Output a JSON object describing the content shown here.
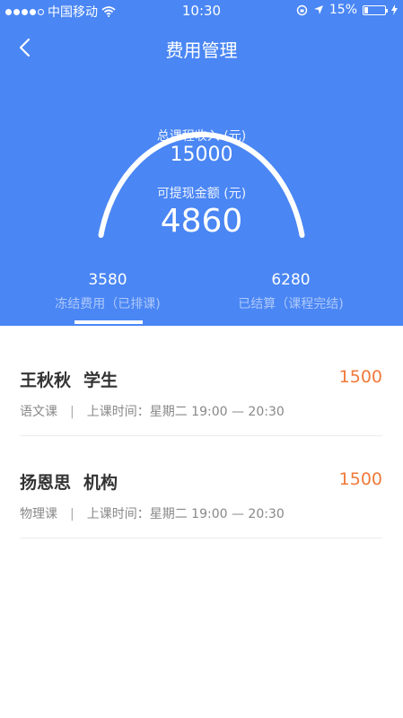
{
  "status_bar": {
    "carrier": "中国移动",
    "time": "10:30",
    "battery": "15%"
  },
  "nav": {
    "title": "费用管理",
    "back_icon": "chevron-left-icon"
  },
  "summary": {
    "income_label": "总课程收入 (元)",
    "income_value": "15000",
    "withdraw_label": "可提现金额 (元)",
    "withdraw_value": "4860"
  },
  "tabs": [
    {
      "value": "3580",
      "label": "冻结费用（已排课)"
    },
    {
      "value": "6280",
      "label": "已结算（课程完结)"
    }
  ],
  "records": [
    {
      "name": "王秋秋",
      "type": "学生",
      "amount": "1500",
      "course": "语文课",
      "sep": "|",
      "schedule": "上课时间：星期二 19:00 — 20:30"
    },
    {
      "name": "扬恩思",
      "type": "机构",
      "amount": "1500",
      "course": "物理课",
      "sep": "|",
      "schedule": "上课时间：星期二 19:00 — 20:30"
    }
  ],
  "colors": {
    "header_bg": "#4a86f4",
    "amount": "#f0793a"
  }
}
